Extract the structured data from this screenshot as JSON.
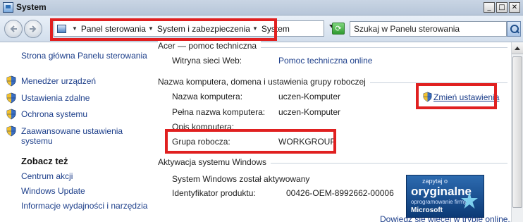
{
  "window": {
    "title": "System",
    "min_label": "_",
    "max_label": "□",
    "close_label": "✕"
  },
  "address_bar": {
    "breadcrumbs": [
      "Panel sterowania",
      "System i zabezpieczenia",
      "System"
    ],
    "search_placeholder": "Szukaj w Panelu sterowania"
  },
  "sidebar": {
    "home_link": "Strona główna Panelu sterowania",
    "tasks": [
      {
        "label": "Menedżer urządzeń",
        "icon": "shield-icon"
      },
      {
        "label": "Ustawienia zdalne",
        "icon": "shield-icon"
      },
      {
        "label": "Ochrona systemu",
        "icon": "shield-icon"
      },
      {
        "label": "Zaawansowane ustawienia systemu",
        "icon": "shield-icon"
      }
    ],
    "advanced_line1": "Zaawansowane ustawienia",
    "advanced_line2": "systemu",
    "see_also_heading": "Zobacz też",
    "see_also": [
      "Centrum akcji",
      "Windows Update",
      "Informacje wydajności i narzędzia"
    ]
  },
  "support": {
    "title": "Acer — pomoc techniczna",
    "website_label": "Witryna sieci Web:",
    "website_value": "Pomoc techniczna online"
  },
  "computer_name": {
    "title": "Nazwa komputera, domena i ustawienia grupy roboczej",
    "change_settings": "Zmień ustawienia",
    "rows": [
      {
        "label": "Nazwa komputera:",
        "value": "uczen-Komputer"
      },
      {
        "label": "Pełna nazwa komputera:",
        "value": "uczen-Komputer"
      },
      {
        "label": "Opis komputera:",
        "value": ""
      },
      {
        "label": "Grupa robocza:",
        "value": "WORKGROUP"
      }
    ]
  },
  "activation": {
    "title": "Aktywacja systemu Windows",
    "status": "System Windows został aktywowany",
    "product_id_label": "Identyfikator produktu:",
    "product_id_value": "00426-OEM-8992662-00006",
    "more_link": "Dowiedz się więcej w trybie online...",
    "badge": {
      "top": "zapytaj o",
      "main": "oryginalne",
      "sub": "oprogramowanie firmy",
      "brand": "Microsoft"
    }
  },
  "colors": {
    "link": "#1c3e8a",
    "highlight": "#e02020"
  }
}
